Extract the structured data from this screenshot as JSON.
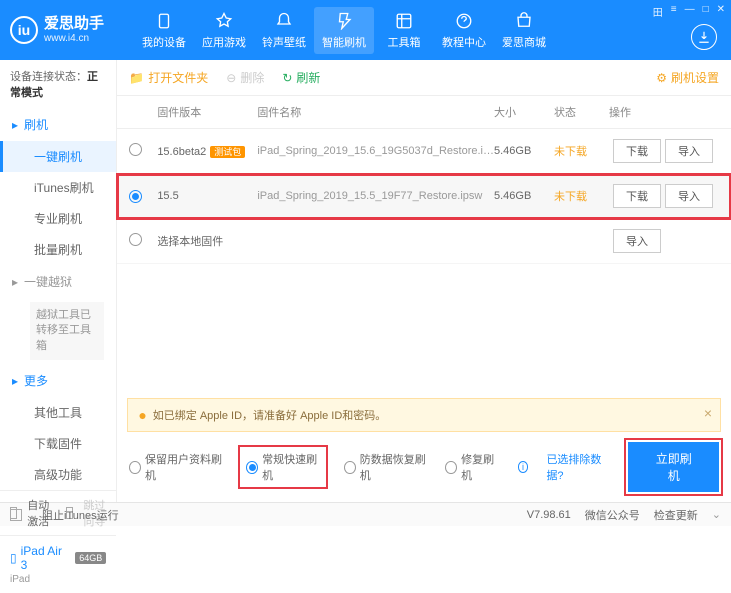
{
  "app": {
    "title": "爱思助手",
    "url": "www.i4.cn"
  },
  "win_controls": [
    "田",
    "≡",
    "—",
    "□",
    "✕"
  ],
  "nav": [
    {
      "label": "我的设备",
      "icon": "device"
    },
    {
      "label": "应用游戏",
      "icon": "app"
    },
    {
      "label": "铃声壁纸",
      "icon": "ring"
    },
    {
      "label": "智能刷机",
      "icon": "flash",
      "active": true
    },
    {
      "label": "工具箱",
      "icon": "tools"
    },
    {
      "label": "教程中心",
      "icon": "help"
    },
    {
      "label": "爱思商城",
      "icon": "shop"
    }
  ],
  "sidebar": {
    "conn_label": "设备连接状态：",
    "conn_value": "正常模式",
    "groups": [
      {
        "title": "刷机",
        "icon": "flash-small",
        "items": [
          "一键刷机",
          "iTunes刷机",
          "专业刷机",
          "批量刷机"
        ],
        "active_index": 0
      },
      {
        "title": "一键越狱",
        "icon": "lock",
        "gray": true,
        "note": "越狱工具已转移至工具箱"
      },
      {
        "title": "更多",
        "icon": "more",
        "items": [
          "其他工具",
          "下载固件",
          "高级功能"
        ]
      }
    ],
    "auto_activate": "自动激活",
    "skip_guide": "跳过向导",
    "device": {
      "name": "iPad Air 3",
      "storage": "64GB",
      "type": "iPad"
    }
  },
  "toolbar": {
    "open_folder": "打开文件夹",
    "delete": "删除",
    "refresh": "刷新",
    "settings": "刷机设置"
  },
  "table": {
    "headers": {
      "version": "固件版本",
      "name": "固件名称",
      "size": "大小",
      "status": "状态",
      "ops": "操作"
    },
    "rows": [
      {
        "version": "15.6beta2",
        "beta": "测试包",
        "name": "iPad_Spring_2019_15.6_19G5037d_Restore.i…",
        "size": "5.46GB",
        "status": "未下载",
        "selected": false,
        "ops": [
          "下载",
          "导入"
        ]
      },
      {
        "version": "15.5",
        "name": "iPad_Spring_2019_15.5_19F77_Restore.ipsw",
        "size": "5.46GB",
        "status": "未下载",
        "selected": true,
        "ops": [
          "下载",
          "导入"
        ]
      }
    ],
    "local_firmware": "选择本地固件",
    "local_op": "导入"
  },
  "warn": {
    "text": "如已绑定 Apple ID，请准备好 Apple ID和密码。"
  },
  "modes": {
    "options": [
      "保留用户资料刷机",
      "常规快速刷机",
      "防数据恢复刷机",
      "修复刷机"
    ],
    "selected_index": 1,
    "exclude_link": "已选排除数据?",
    "flash_btn": "立即刷机"
  },
  "statusbar": {
    "block_itunes": "阻止iTunes运行",
    "version": "V7.98.61",
    "wechat": "微信公众号",
    "check_update": "检查更新"
  }
}
